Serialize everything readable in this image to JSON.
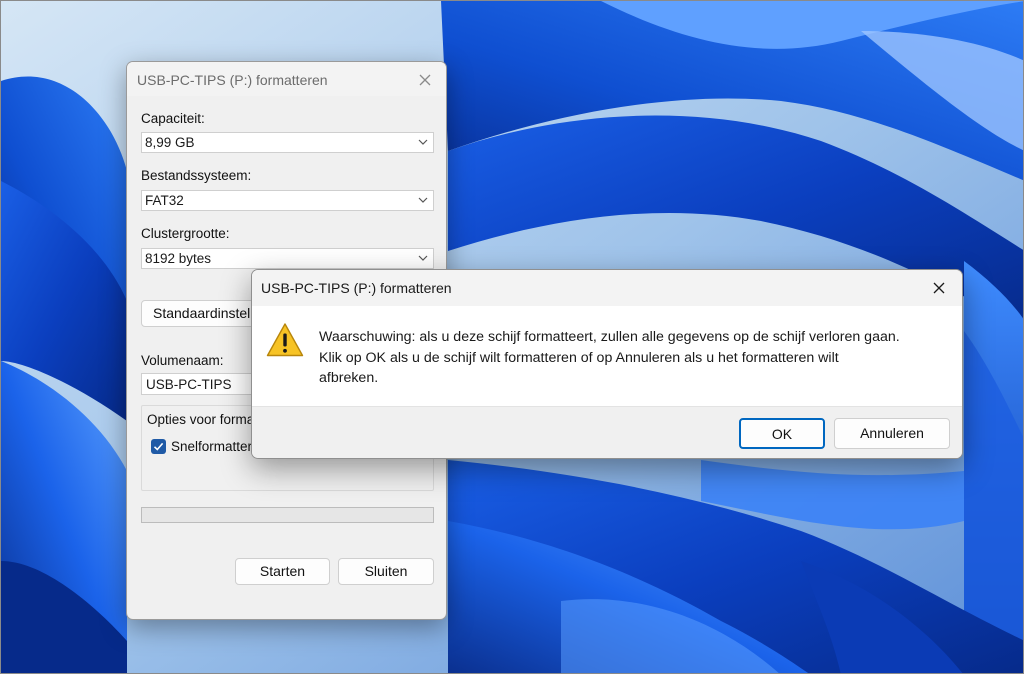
{
  "format_dialog": {
    "title": "USB-PC-TIPS (P:) formatteren",
    "capacity_label": "Capaciteit:",
    "capacity_value": "8,99 GB",
    "filesystem_label": "Bestandssysteem:",
    "filesystem_value": "FAT32",
    "cluster_label": "Clustergrootte:",
    "cluster_value": "8192 bytes",
    "restore_defaults_label": "Standaardinstelli",
    "volume_label": "Volumenaam:",
    "volume_value": "USB-PC-TIPS",
    "options_label": "Opties voor forma",
    "quick_format_label": "Snelformatter",
    "quick_format_checked": true,
    "progress": 0,
    "start_label": "Starten",
    "close_label": "Sluiten"
  },
  "warning_dialog": {
    "title": "USB-PC-TIPS (P:) formatteren",
    "message_line1": "Waarschuwing: als u deze schijf formatteert, zullen alle gegevens op de schijf verloren gaan.",
    "message_line2": "Klik op OK als u de schijf wilt formatteren of op Annuleren als u het formatteren wilt",
    "message_line3": "afbreken.",
    "ok_label": "OK",
    "cancel_label": "Annuleren",
    "icon": "warning-icon"
  },
  "colors": {
    "accent": "#0067c0",
    "checkbox": "#1f5aa6",
    "warning": "#f7c325"
  }
}
